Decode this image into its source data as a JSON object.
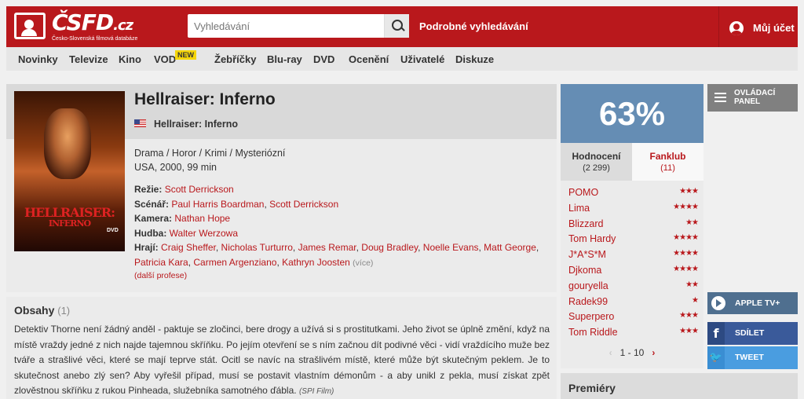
{
  "header": {
    "logo_text": "ČSFD",
    "logo_suffix": ".cz",
    "logo_tagline": "Česko-Slovenská filmová databáze",
    "search_placeholder": "Vyhledávání",
    "advanced_search": "Podrobné vyhledávání",
    "account": "Můj účet"
  },
  "nav": {
    "items": [
      "Novinky",
      "Televize",
      "Kino",
      "VOD",
      "Žebříčky",
      "Blu-ray",
      "DVD",
      "Ocenění",
      "Uživatelé",
      "Diskuze"
    ],
    "vod_badge": "NEW"
  },
  "film": {
    "title": "Hellraiser: Inferno",
    "original_title": "Hellraiser: Inferno",
    "genres": "Drama / Horor / Krimi / Mysteriózní",
    "origin": "USA, 2000, 99 min",
    "poster_title_line1": "HELLRAISER:",
    "poster_title_line2": "INFERNO",
    "poster_badge": "DVD",
    "director_label": "Režie:",
    "directors": [
      "Scott Derrickson"
    ],
    "writer_label": "Scénář:",
    "writers": [
      "Paul Harris Boardman",
      "Scott Derrickson"
    ],
    "camera_label": "Kamera:",
    "camera": [
      "Nathan Hope"
    ],
    "music_label": "Hudba:",
    "music": [
      "Walter Werzowa"
    ],
    "cast_label": "Hrají:",
    "cast": [
      "Craig Sheffer",
      "Nicholas Turturro",
      "James Remar",
      "Doug Bradley",
      "Noelle Evans",
      "Matt George",
      "Patricia Kara",
      "Carmen Argenziano",
      "Kathryn Joosten"
    ],
    "more": "(více)",
    "other_professions": "(další profese)"
  },
  "plot": {
    "heading": "Obsahy",
    "count": "(1)",
    "text": "Detektiv Thorne není žádný anděl - paktuje se zločinci, bere drogy a užívá si s prostitutkami. Jeho život se úplně změní, když na místě vraždy jedné z nich najde tajemnou skříňku. Po jejím otevření se s ním začnou dít podivné věci - vidí vraždícího muže bez tváře a strašlivé věci, které se mají teprve stát. Ocitl se navíc na strašlivém místě, které může být skutečným peklem. Je to skutečnost anebo zlý sen? Aby vyřešil případ, musí se postavit vlastním démonům - a aby unikl z pekla, musí získat zpět zlověstnou skříňku z rukou Pinheada, služebníka samotného ďábla.",
    "source": "(SPI Film)"
  },
  "rating": {
    "score": "63%",
    "tab_ratings": "Hodnocení",
    "tab_ratings_count": "(2 299)",
    "tab_fanclub": "Fanklub",
    "tab_fanclub_count": "(11)",
    "users": [
      {
        "name": "POMO",
        "stars": "★★★"
      },
      {
        "name": "Lima",
        "stars": "★★★★"
      },
      {
        "name": "Blizzard",
        "stars": "★★"
      },
      {
        "name": "Tom Hardy",
        "stars": "★★★★"
      },
      {
        "name": "J*A*S*M",
        "stars": "★★★★"
      },
      {
        "name": "Djkoma",
        "stars": "★★★★"
      },
      {
        "name": "gouryella",
        "stars": "★★"
      },
      {
        "name": "Radek99",
        "stars": "★"
      },
      {
        "name": "Superpero",
        "stars": "★★★"
      },
      {
        "name": "Tom Riddle",
        "stars": "★★★"
      }
    ],
    "pager": "1 - 10"
  },
  "sidebar": {
    "control_panel": "OVLÁDACÍ PANEL",
    "apple_tv": "APPLE TV+",
    "share": "SDÍLET",
    "tweet": "TWEET",
    "premieres": "Premiéry"
  },
  "colors": {
    "brand": "#b9181c",
    "score_bg": "#658db4"
  }
}
